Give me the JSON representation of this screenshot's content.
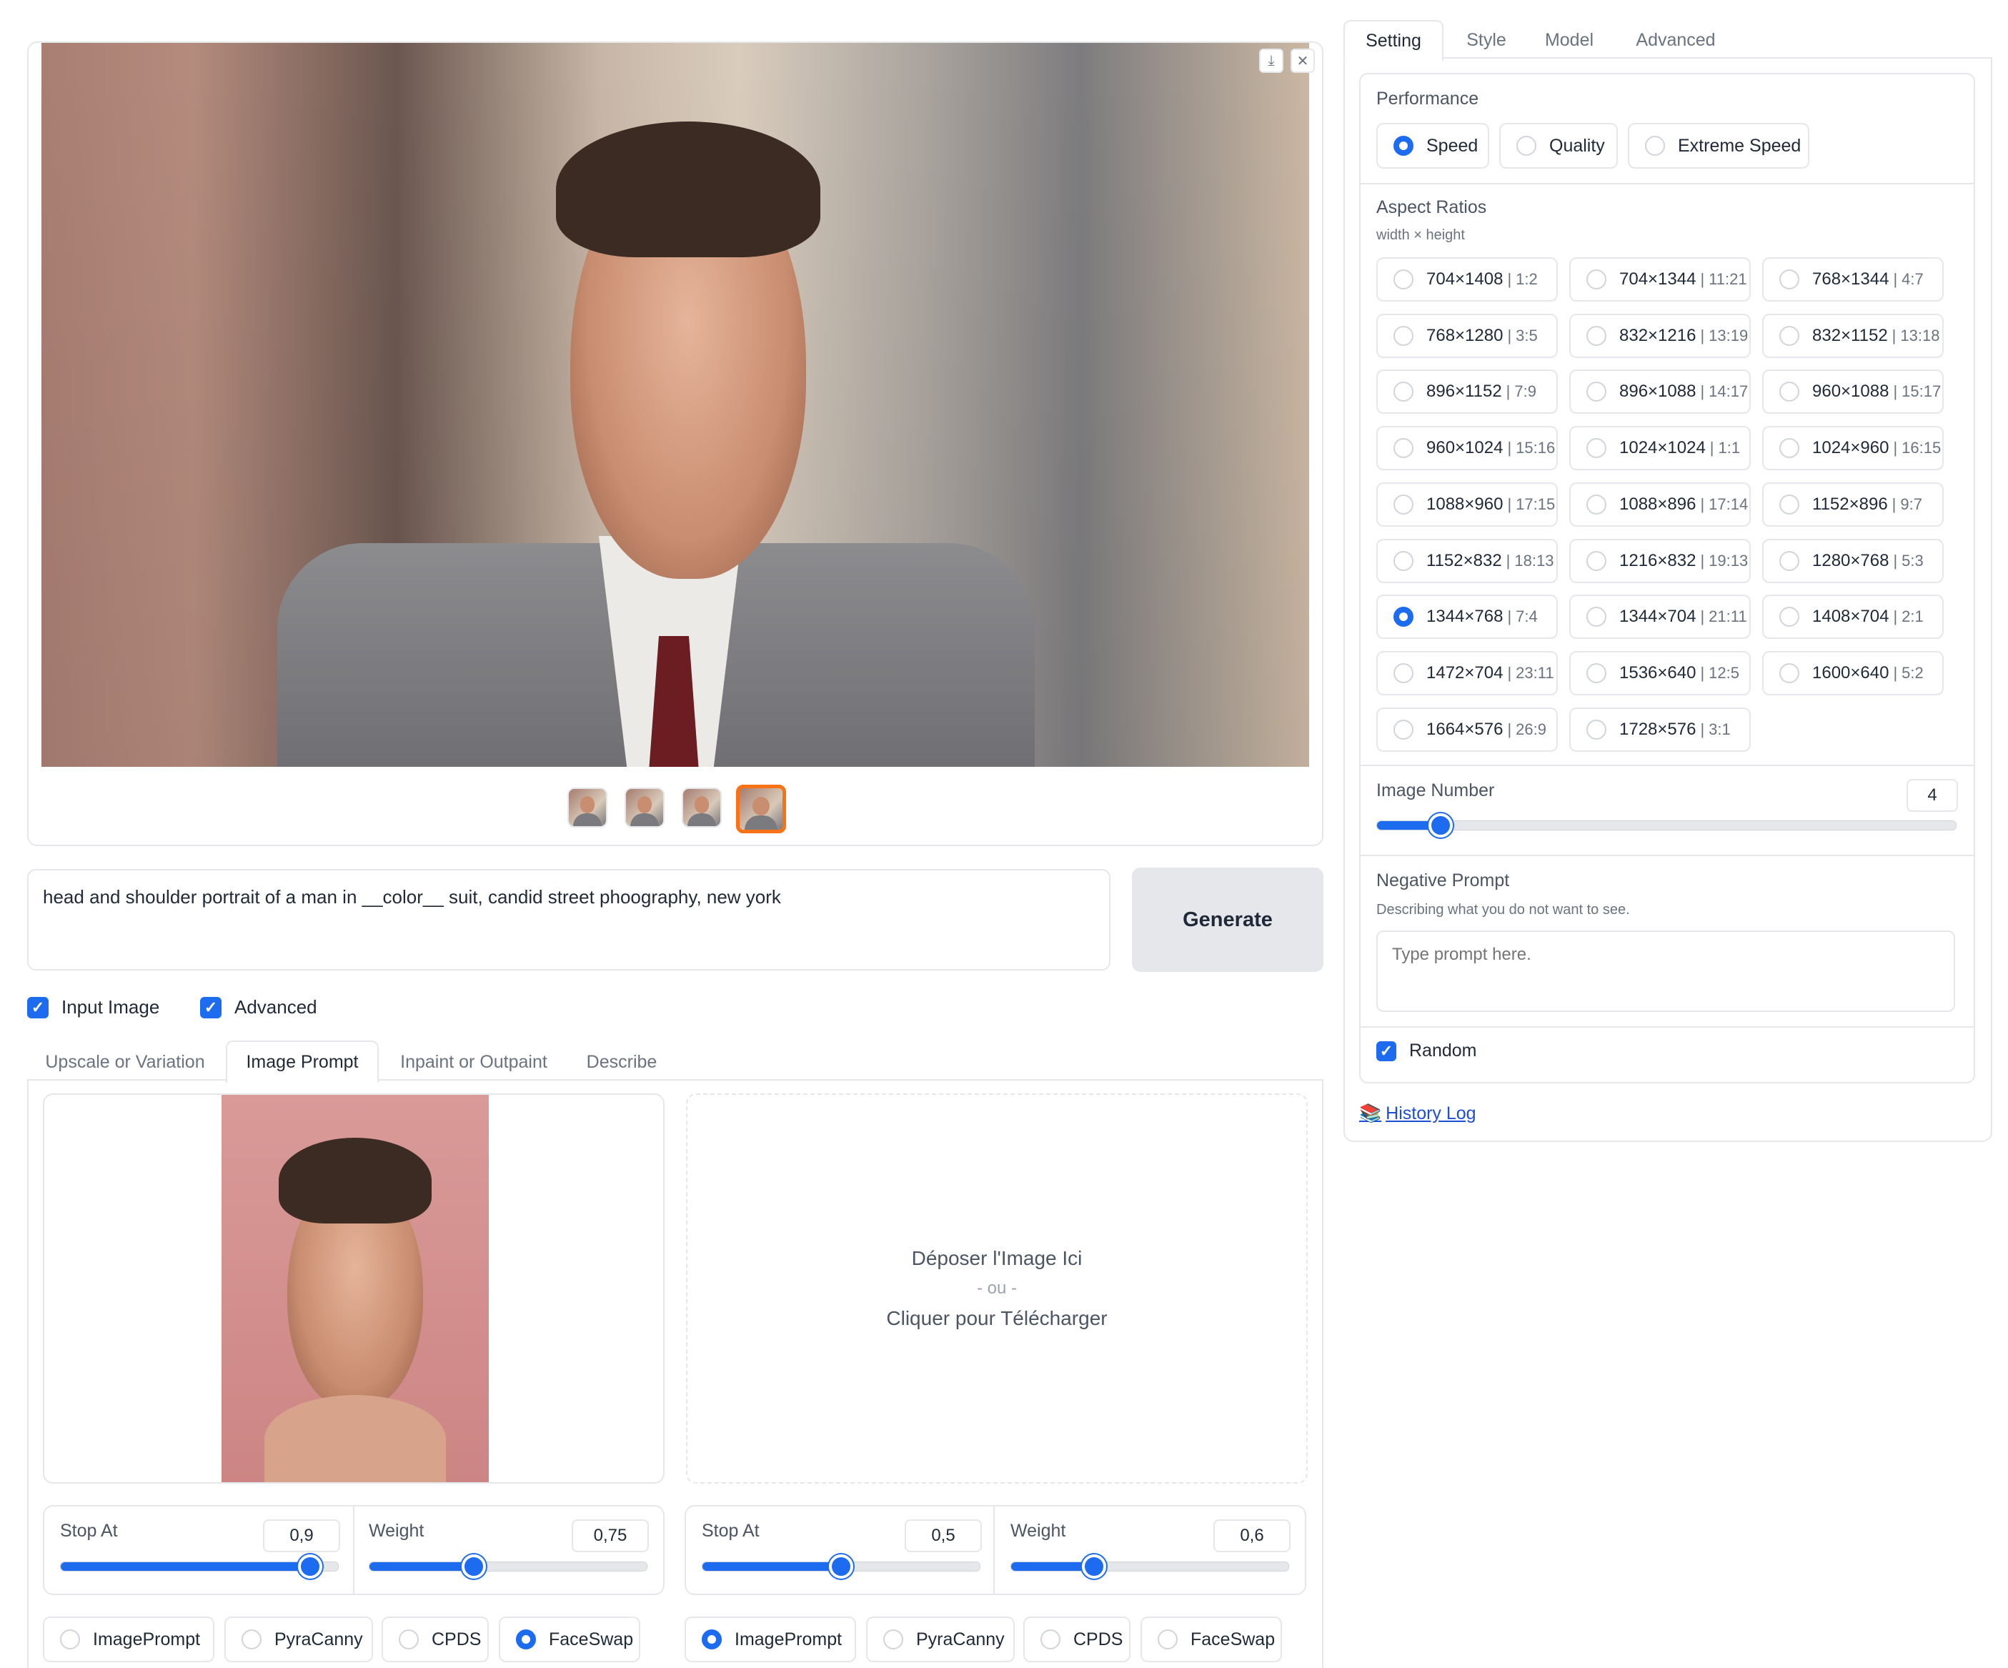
{
  "left": {
    "prompt_text": "head and shoulder portrait of a man in __color__ suit, candid street phoography, new york",
    "generate_label": "Generate",
    "checkboxes": {
      "input_image": "Input Image",
      "advanced": "Advanced"
    },
    "tabs": [
      "Upscale or Variation",
      "Image Prompt",
      "Inpaint or Outpaint",
      "Describe"
    ],
    "dropzone": {
      "line1": "Déposer l'Image Ici",
      "line2": "- ou -",
      "line3": "Cliquer pour Télécharger"
    },
    "slot1": {
      "stop_at_label": "Stop At",
      "stop_at_value": "0,9",
      "stop_at_fraction": 0.9,
      "weight_label": "Weight",
      "weight_value": "0,75",
      "weight_fraction": 0.375,
      "options": [
        "ImagePrompt",
        "PyraCanny",
        "CPDS",
        "FaceSwap"
      ],
      "selected": "FaceSwap"
    },
    "slot2": {
      "stop_at_label": "Stop At",
      "stop_at_value": "0,5",
      "stop_at_fraction": 0.5,
      "weight_label": "Weight",
      "weight_value": "0,6",
      "weight_fraction": 0.3,
      "options": [
        "ImagePrompt",
        "PyraCanny",
        "CPDS",
        "FaceSwap"
      ],
      "selected": "ImagePrompt"
    }
  },
  "right": {
    "tabs": [
      "Setting",
      "Style",
      "Model",
      "Advanced"
    ],
    "performance": {
      "label": "Performance",
      "options": [
        "Speed",
        "Quality",
        "Extreme Speed"
      ],
      "selected": "Speed"
    },
    "aspect": {
      "label": "Aspect Ratios",
      "sublabel": "width × height",
      "options": [
        [
          "704×1408",
          "1:2"
        ],
        [
          "704×1344",
          "11:21"
        ],
        [
          "768×1344",
          "4:7"
        ],
        [
          "768×1280",
          "3:5"
        ],
        [
          "832×1216",
          "13:19"
        ],
        [
          "832×1152",
          "13:18"
        ],
        [
          "896×1152",
          "7:9"
        ],
        [
          "896×1088",
          "14:17"
        ],
        [
          "960×1088",
          "15:17"
        ],
        [
          "960×1024",
          "15:16"
        ],
        [
          "1024×1024",
          "1:1"
        ],
        [
          "1024×960",
          "16:15"
        ],
        [
          "1088×960",
          "17:15"
        ],
        [
          "1088×896",
          "17:14"
        ],
        [
          "1152×896",
          "9:7"
        ],
        [
          "1152×832",
          "18:13"
        ],
        [
          "1216×832",
          "19:13"
        ],
        [
          "1280×768",
          "5:3"
        ],
        [
          "1344×768",
          "7:4"
        ],
        [
          "1344×704",
          "21:11"
        ],
        [
          "1408×704",
          "2:1"
        ],
        [
          "1472×704",
          "23:11"
        ],
        [
          "1536×640",
          "12:5"
        ],
        [
          "1600×640",
          "5:2"
        ],
        [
          "1664×576",
          "26:9"
        ],
        [
          "1728×576",
          "3:1"
        ]
      ],
      "selected_index": 18
    },
    "image_number": {
      "label": "Image Number",
      "value": "4",
      "fraction": 0.11
    },
    "negative_prompt": {
      "label": "Negative Prompt",
      "sublabel": "Describing what you do not want to see.",
      "placeholder": "Type prompt here."
    },
    "random_label": "Random",
    "history_link": "History Log",
    "history_icon": "📚"
  },
  "colors": {
    "accent": "#1d6cf0",
    "selected_thumb_border": "#f97316"
  }
}
